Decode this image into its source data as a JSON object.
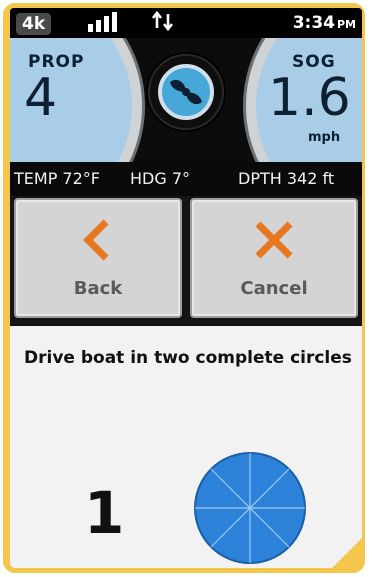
{
  "status_bar": {
    "network_badge": "4k",
    "signal_icon": "signal-bars-icon",
    "data_icon": "data-transfer-arrows-icon",
    "time": "3:34",
    "ampm": "PM"
  },
  "gauges": {
    "prop": {
      "label": "PROP",
      "value": "4"
    },
    "sog": {
      "label": "SOG",
      "value": "1.6",
      "unit": "mph"
    },
    "center_icon": "propeller-icon"
  },
  "telemetry": {
    "temp": "TEMP 72°F",
    "heading": "HDG 7°",
    "depth": "DPTH  342 ft"
  },
  "buttons": {
    "back": {
      "label": "Back",
      "icon": "chevron-left-icon"
    },
    "cancel": {
      "label": "Cancel",
      "icon": "close-x-icon"
    }
  },
  "instruction": {
    "text": "Drive boat in two complete circles",
    "circle_count": "1",
    "progress_icon": "circle-progress-icon"
  },
  "colors": {
    "accent_orange": "#e87722",
    "gauge_blue": "#a9cde7",
    "frame_yellow": "#f3c64c",
    "circle_blue": "#2b82d8"
  }
}
